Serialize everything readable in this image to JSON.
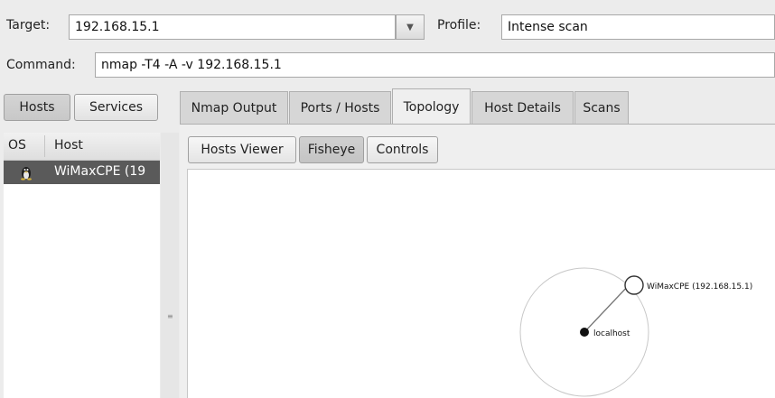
{
  "target": {
    "label": "Target:",
    "value": "192.168.15.1"
  },
  "profile": {
    "label": "Profile:",
    "value": "Intense scan"
  },
  "command": {
    "label": "Command:",
    "value": "nmap -T4 -A -v 192.168.15.1"
  },
  "left_tabs": {
    "hosts": "Hosts",
    "services": "Services",
    "active": "Hosts"
  },
  "host_list": {
    "columns": {
      "os": "OS",
      "host": "Host"
    },
    "rows": [
      {
        "host": "WiMaxCPE (19",
        "os_icon": "linux-penguin-icon",
        "selected": true
      }
    ]
  },
  "main_tabs": {
    "items": [
      "Nmap Output",
      "Ports / Hosts",
      "Topology",
      "Host Details",
      "Scans"
    ],
    "active": "Topology"
  },
  "topology": {
    "buttons": [
      "Hosts Viewer",
      "Fisheye",
      "Controls"
    ],
    "active_button": "Fisheye",
    "nodes": {
      "center": "localhost",
      "target": "WiMaxCPE (192.168.15.1)"
    }
  },
  "icons": {
    "dropdown": "▼",
    "grip": "≡"
  }
}
